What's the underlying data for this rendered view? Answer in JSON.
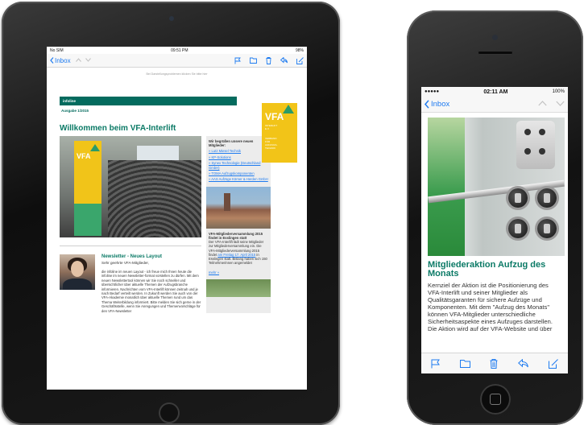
{
  "ipad": {
    "status": {
      "carrier": "No SIM",
      "time": "09:51 PM",
      "battery": "98%"
    },
    "toolbar": {
      "back_label": "Inbox",
      "icons": [
        "chevron-left-icon",
        "up-arrow-icon",
        "down-arrow-icon",
        "flag-icon",
        "folder-icon",
        "trash-icon",
        "reply-icon",
        "compose-icon"
      ]
    },
    "mail": {
      "display_note": "Bei Darstellungsproblemen klicken Sie bitte hier",
      "logo": {
        "name": "VFA",
        "sub": [
          "INTERLIFT",
          "E.V."
        ],
        "sub2": [
          "VERBAND",
          "FÜR",
          "AUFZUGS-",
          "TECHNIK"
        ]
      },
      "bar_label": "infoline",
      "issue": "Ausgabe 1/2015",
      "headline": "Willkommen beim VFA-Interlift",
      "hero_banner": {
        "name": "VFA",
        "caption": "Herzlich willkommen"
      },
      "newsletter": {
        "title": "Newsletter - Neues Layout",
        "greeting": "Sehr geehrte VFA-Mitglieder,",
        "body": "die infoline im neuen Layout - ich freue mich Ihnen heute die infoline im neuen Newsletter-format vorstellen zu dürfen. Mit dem neuen Newslettertool können wir Sie noch schneller und übersichtlicher über aktuelle Themen der Aufzugsbranche informieren. Nachrichten vom VFA-Interlift können zeitnah und je nach Bedarf verteilt werden. In Zukunft werden Sie auch von der VFA-Akademie monatlich über aktuelle Themen rund um das Thema Weiterbildung informiert. Bitte melden Sie sich gerne in der Geschäftsstelle, wenn Sie Anregungen und Themenvorschläge für den VFA-Newsletter"
      },
      "sidebar": {
        "welcome_title": "Wir begrüßen unsere neuen Mitglieder:",
        "members": [
          "» Lutz Miesel Technik",
          "» KP-Solutions",
          "» Synex Technologie (Deutschland GmbH)",
          "» TOMA Aufzugskomponenten",
          "» AAS Aufzüge Körner & Herden GmbH"
        ],
        "event_title": "VFA-Mitgliederversammlung 2015 findet in Esslingen statt",
        "event_body_1": "Der VFA-Interlift lädt seine Mitglieder zur Mitgliederversammlung ein. Die VFA-Mitgliederversammlung 2015 findet",
        "event_link": "am Freitag 17. April 2015",
        "event_body_2": "in Esslingen statt. Bislang haben sich 150 Teilnehmerinnen angemeldet",
        "more": "mehr »"
      }
    }
  },
  "iphone": {
    "status": {
      "signal": "●●●●● ",
      "time": "02:11 AM",
      "battery": "100%"
    },
    "nav": {
      "back_label": "Inbox",
      "arrows": "︿ ﹀"
    },
    "article": {
      "title": "Mitgliederaktion Aufzug des Monats",
      "body": "Kernziel der Aktion ist die Positionierung des VFA-Interlift und seiner Mitglieder als Qualitätsgaranten für sichere Aufzüge und Komponenten. Mit dem \"Aufzug des Monats\" können VFA-Mitglieder unterschiedliche Sicherheitsaspekte eines Aufzuges darstellen. Die Aktion wird auf der VFA-Website und über"
    },
    "toolbar_icons": [
      "flag-icon",
      "folder-icon",
      "trash-icon",
      "reply-icon",
      "compose-icon"
    ]
  }
}
